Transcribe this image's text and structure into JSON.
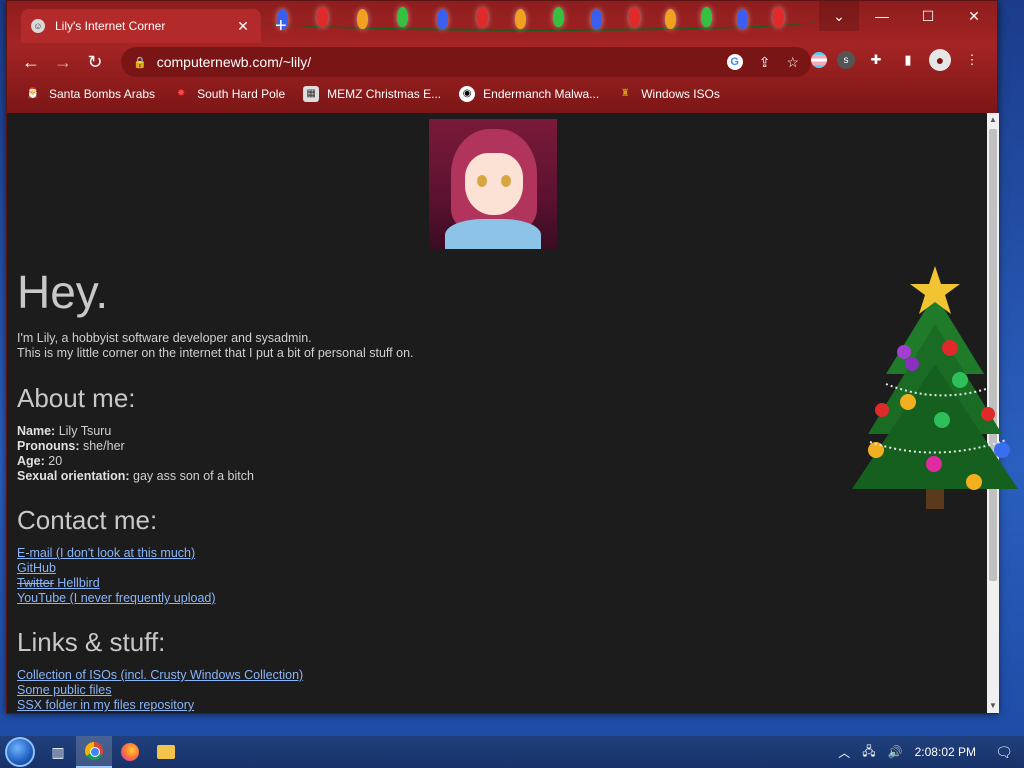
{
  "browser": {
    "tab_title": "Lily's Internet Corner",
    "url": "computernewb.com/~lily/",
    "bookmarks": [
      {
        "label": "Santa Bombs Arabs"
      },
      {
        "label": "South Hard Pole"
      },
      {
        "label": "MEMZ Christmas E..."
      },
      {
        "label": "Endermanch Malwa..."
      },
      {
        "label": "Windows ISOs"
      }
    ],
    "colors": {
      "frame": "#8e1d1d",
      "link": "#8ab4f8",
      "page_bg": "#1c1c1c"
    }
  },
  "page": {
    "heading": "Hey.",
    "intro_line1": "I'm Lily, a hobbyist software developer and sysadmin.",
    "intro_line2": "This is my little corner on the internet that I put a bit of personal stuff on.",
    "about": {
      "title": "About me:",
      "name_label": "Name:",
      "name_value": "Lily Tsuru",
      "pronouns_label": "Pronouns:",
      "pronouns_value": "she/her",
      "age_label": "Age:",
      "age_value": "20",
      "orientation_label": "Sexual orientation:",
      "orientation_value": "gay ass son of a bitch"
    },
    "contact": {
      "title": "Contact me:",
      "email": "E-mail (I don't look at this much)",
      "github": "GitHub",
      "twitter_struck": "Twitter",
      "twitter_rest": "Hellbird",
      "youtube": "YouTube (I never frequently upload)"
    },
    "links": {
      "title": "Links & stuff:",
      "isos": "Collection of ISOs (incl. Crusty Windows Collection)",
      "public_files": "Some public files",
      "ssx": "SSX folder in my files repository"
    }
  },
  "taskbar": {
    "clock": "2:08:02 PM",
    "icons": [
      "start-orb",
      "task-view-icon",
      "chrome-icon",
      "firefox-icon",
      "file-explorer-icon"
    ]
  }
}
